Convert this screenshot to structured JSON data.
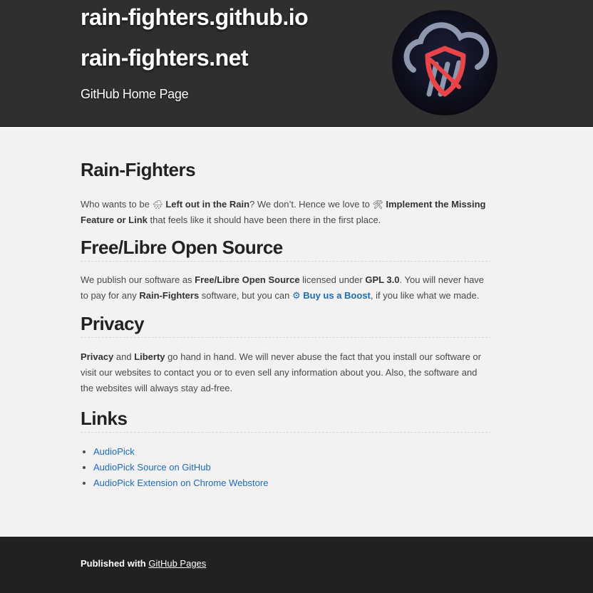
{
  "header": {
    "title_1": "rain-fighters.github.io",
    "title_2": "rain-fighters.net",
    "tagline": "GitHub Home Page",
    "logo_icon": "rain-cloud-shield-icon"
  },
  "intro": {
    "heading": "Rain-Fighters",
    "t1": "Who wants to be ",
    "emoji_rain": "🌧",
    "b1": "Left out in the Rain",
    "t2": "? We don’t. Hence we love to ",
    "emoji_tools": "🛠",
    "b2": "Implement the Missing Feature or Link",
    "t3": " that feels like it should have been there in the first place."
  },
  "foss": {
    "heading": "Free/Libre Open Source",
    "t1": "We publish our software as ",
    "b1": "Free/Libre Open Source",
    "t2": " licensed under ",
    "b2": "GPL 3.0",
    "t3": ". You will never have to pay for any ",
    "b3": "Rain-Fighters",
    "t4": " software, but you can ",
    "boost_link": "⚙ Buy us a Boost",
    "t5": ", if you like what we made."
  },
  "privacy": {
    "heading": "Privacy",
    "b1": "Privacy",
    "t1": " and ",
    "b2": "Liberty",
    "t2": " go hand in hand. We will never abuse the fact that you install our software or visit our websites to contact you or to even sell any information about you. Also, the software and the websites will always stay ad-free."
  },
  "links": {
    "heading": "Links",
    "items": [
      "AudioPick",
      "AudioPick Source on GitHub",
      "AudioPick Extension on Chrome Webstore"
    ]
  },
  "footer": {
    "prefix": "Published with ",
    "link": "GitHub Pages"
  },
  "colors": {
    "header_bg": "#2f2f2f",
    "body_bg": "#f2f2f2",
    "footer_bg": "#212121",
    "link": "#1e6bb8",
    "logo_accent": "#e8454a"
  }
}
